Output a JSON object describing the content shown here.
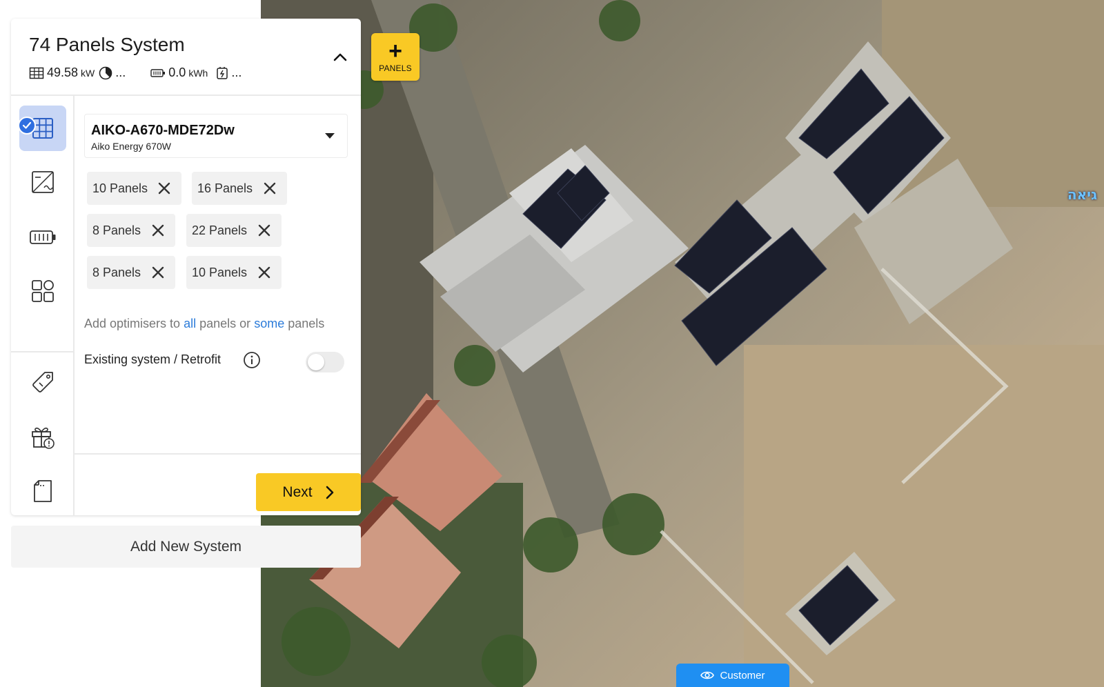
{
  "system": {
    "title": "74 Panels System",
    "power_value": "49.58",
    "power_unit": "kW",
    "production_more": "...",
    "battery_value": "0.0",
    "battery_unit": "kWh",
    "charger_more": "...",
    "collapse_icon": "chevron-up-icon"
  },
  "sidebar": {
    "items": [
      {
        "name": "panels",
        "icon": "solar-grid-icon",
        "active": true,
        "completed": true
      },
      {
        "name": "inverter",
        "icon": "inverter-icon",
        "active": false
      },
      {
        "name": "battery",
        "icon": "battery-icon",
        "active": false
      },
      {
        "name": "components",
        "icon": "grid-squares-icon",
        "active": false
      },
      {
        "name": "pricing",
        "icon": "price-tag-icon",
        "active": false
      },
      {
        "name": "incentives",
        "icon": "gift-icon",
        "active": false
      },
      {
        "name": "documents",
        "icon": "document-icon",
        "active": false
      }
    ]
  },
  "module": {
    "name": "AIKO-A670-MDE72Dw",
    "subtitle": "Aiko Energy 670W"
  },
  "chips": [
    {
      "label": "10 Panels"
    },
    {
      "label": "16 Panels"
    },
    {
      "label": "8 Panels"
    },
    {
      "label": "22 Panels"
    },
    {
      "label": "8 Panels"
    },
    {
      "label": "10 Panels"
    }
  ],
  "optimisers": {
    "prefix": "Add optimisers to",
    "all_link": "all",
    "middle": "panels or",
    "some_link": "some",
    "suffix": "panels"
  },
  "retrofit": {
    "label": "Existing system / Retrofit",
    "enabled": false
  },
  "next_button": {
    "label": "Next"
  },
  "add_system_button": {
    "label": "Add New System"
  },
  "add_panels_button": {
    "label": "PANELS"
  },
  "customer_view": {
    "label": "Customer"
  },
  "map": {
    "place_label": "גיאה"
  },
  "colors": {
    "accent_yellow": "#f9c925",
    "link_blue": "#2b7bd9",
    "active_bg": "#c8d6f5",
    "check_blue": "#2f6fe0",
    "customer_blue": "#1f8ff2"
  }
}
